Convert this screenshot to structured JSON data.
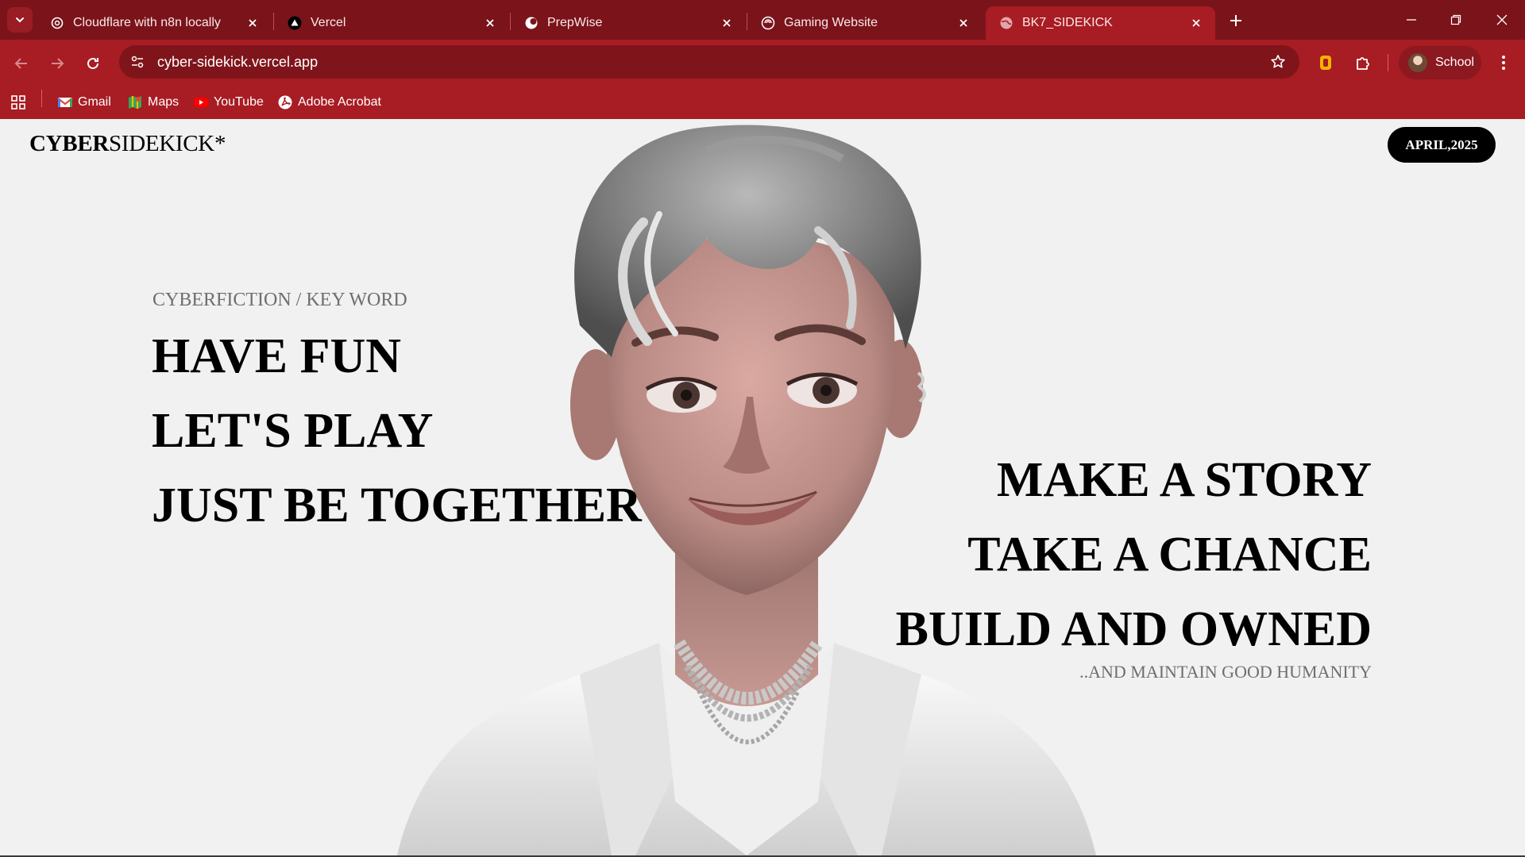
{
  "browser": {
    "tabs": [
      {
        "title": "Cloudflare with n8n locally",
        "icon": "openai-icon"
      },
      {
        "title": "Vercel",
        "icon": "vercel-icon"
      },
      {
        "title": "PrepWise",
        "icon": "prepwise-icon"
      },
      {
        "title": "Gaming Website",
        "icon": "swirl-icon"
      },
      {
        "title": "BK7_SIDEKICK",
        "icon": "globe-icon",
        "active": true
      }
    ],
    "url": "cyber-sidekick.vercel.app",
    "profile_label": "School",
    "bookmarks": [
      {
        "label": "Gmail",
        "icon": "gmail-icon"
      },
      {
        "label": "Maps",
        "icon": "maps-icon"
      },
      {
        "label": "YouTube",
        "icon": "youtube-icon"
      },
      {
        "label": "Adobe Acrobat",
        "icon": "acrobat-icon"
      }
    ],
    "colors": {
      "tabbar": "#7a141a",
      "toolbar": "#a81c23"
    }
  },
  "site": {
    "logo_bold": "CYBER",
    "logo_rest": "SIDEKICK*",
    "date_badge": "APRIL,2025",
    "kicker": "CYBERFICTION / KEY WORD",
    "left_lines": [
      "HAVE FUN",
      "LET'S PLAY",
      "JUST BE TOGETHER"
    ],
    "right_lines": [
      "MAKE A STORY",
      "TAKE A CHANCE",
      "BUILD AND OWNED"
    ],
    "tagline": "..AND MAINTAIN GOOD HUMANITY"
  }
}
